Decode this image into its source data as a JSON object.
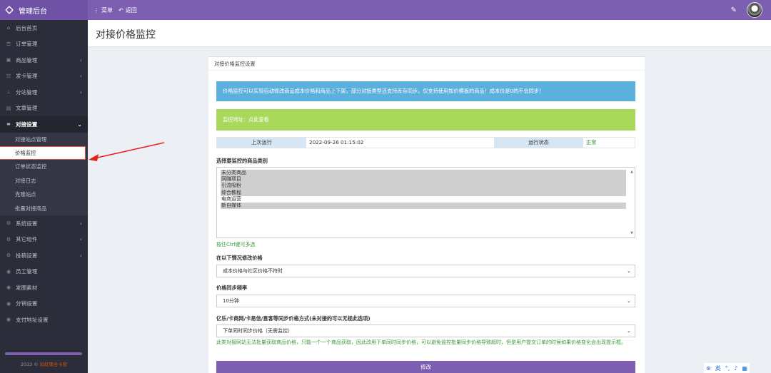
{
  "header": {
    "brand": "管理后台",
    "nav": [
      {
        "icon": "menu-icon",
        "label": "菜单"
      },
      {
        "icon": "back-icon",
        "label": "返回"
      }
    ]
  },
  "sidebar": {
    "items": [
      {
        "icon": "home-icon",
        "label": "后台首页",
        "has_children": false
      },
      {
        "icon": "list-icon",
        "label": "订单管理",
        "has_children": false
      },
      {
        "icon": "cart-icon",
        "label": "商品管理",
        "has_children": true
      },
      {
        "icon": "card-icon",
        "label": "发卡管理",
        "has_children": true
      },
      {
        "icon": "sitemap-icon",
        "label": "分站管理",
        "has_children": true
      },
      {
        "icon": "article-icon",
        "label": "文章管理",
        "has_children": false
      },
      {
        "icon": "link-icon",
        "label": "对接设置",
        "has_children": true,
        "open": true
      }
    ],
    "submenu": [
      {
        "label": "对接站点管理",
        "active": false
      },
      {
        "label": "价格监控",
        "active": true
      },
      {
        "label": "订单状态监控",
        "active": false
      },
      {
        "label": "对接日志",
        "active": false
      },
      {
        "label": "克隆站点",
        "active": false
      },
      {
        "label": "批量对接商品",
        "active": false
      }
    ],
    "items_after": [
      {
        "icon": "gear-icon",
        "label": "系统设置",
        "has_children": true
      },
      {
        "icon": "puzzle-icon",
        "label": "其它组件",
        "has_children": true
      },
      {
        "icon": "gears-icon",
        "label": "投稿设置",
        "has_children": true
      },
      {
        "icon": "user-icon",
        "label": "员工管理",
        "has_children": false
      },
      {
        "icon": "image-icon",
        "label": "发圈素材",
        "has_children": false
      },
      {
        "icon": "share-icon",
        "label": "分销设置",
        "has_children": false
      },
      {
        "icon": "pay-icon",
        "label": "支付地址del设置",
        "has_children": false
      }
    ],
    "footer": {
      "year": "2023 ©",
      "link": "彩虹聚合卡密"
    }
  },
  "page": {
    "title": "对接价格监控",
    "panel_title": "对接价格监控设置",
    "info_alert": "价格监控可以实现自动修改商品成本价格和商品上下架，部分对接类型还支持库存同步。仅支持使用加价模板的商品！成本价是0的不会同步！",
    "success_alert": "监控地址：点此查看",
    "status": {
      "last_run_label": "上次运行",
      "last_run_value": "2022-09-26 01:15:02",
      "state_label": "运行状态",
      "state_value": "正常"
    },
    "category_label": "选择要监控的商品类别",
    "categories": [
      {
        "label": "未分类商品",
        "selected": true
      },
      {
        "label": "网赚项目",
        "selected": true
      },
      {
        "label": "引流吸粉",
        "selected": true
      },
      {
        "label": "综合教程",
        "selected": true
      },
      {
        "label": "电商运营",
        "selected": false
      },
      {
        "label": "新自媒体",
        "selected": true
      }
    ],
    "multi_hint": "按住Ctrl键可多选",
    "change_label": "在以下情况修改价格",
    "change_value": "成本价格与社区价格不符时",
    "freq_label": "价格同步频率",
    "freq_value": "10分钟",
    "method_label": "亿乐/卡商网/卡易信/直客等同步价格方式(未对接的可以无视此选项)",
    "method_value": "下单同时同步价格（无需监控）",
    "method_note": "此类对接网站无法批量获取商品价格，只能一个一个商品获取，因此改用下单同时同步价格，可以避免监控批量同步价格导致超时，但是用户提交订单的时候如果价格变化会出现提示框。",
    "submit_label": "修改"
  },
  "tray": {
    "lang": "英"
  }
}
